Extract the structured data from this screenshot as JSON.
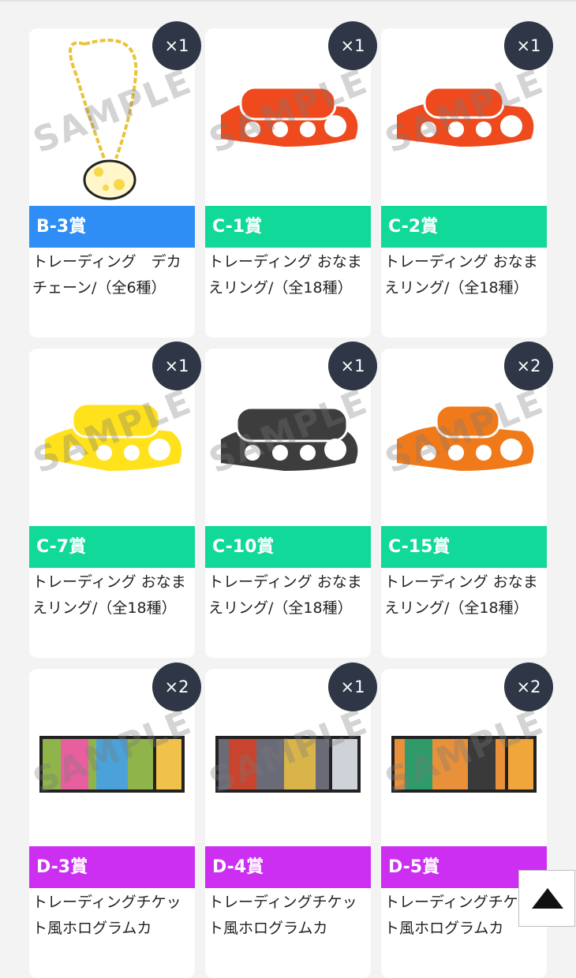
{
  "watermark": "SAMPLE",
  "colors": {
    "blue": "#2e8ef5",
    "green": "#10d99a",
    "purple": "#cc2ff2",
    "badge": "#2f3645"
  },
  "scroll_top_icon": "triangle-up-icon",
  "cards": [
    {
      "prize": "B-3賞",
      "color": "#2e8ef5",
      "qty": "×1",
      "desc": "トレーディング　デカチェーン/（全6種）",
      "image": "chain"
    },
    {
      "prize": "C-1賞",
      "color": "#10d99a",
      "qty": "×1",
      "desc": "トレーディング おなまえリング/（全18種）",
      "image": "ring-red-1"
    },
    {
      "prize": "C-2賞",
      "color": "#10d99a",
      "qty": "×1",
      "desc": "トレーディング おなまえリング/（全18種）",
      "image": "ring-red-2"
    },
    {
      "prize": "C-7賞",
      "color": "#10d99a",
      "qty": "×1",
      "desc": "トレーディング おなまえリング/（全18種）",
      "image": "ring-yellow"
    },
    {
      "prize": "C-10賞",
      "color": "#10d99a",
      "qty": "×1",
      "desc": "トレーディング おなまえリング/（全18種）",
      "image": "ring-black"
    },
    {
      "prize": "C-15賞",
      "color": "#10d99a",
      "qty": "×2",
      "desc": "トレーディング おなまえリング/（全18種）",
      "image": "ring-orange"
    },
    {
      "prize": "D-3賞",
      "color": "#cc2ff2",
      "qty": "×2",
      "desc": "トレーディングチケット風ホログラムカ",
      "image": "ticket-1"
    },
    {
      "prize": "D-4賞",
      "color": "#cc2ff2",
      "qty": "×1",
      "desc": "トレーディングチケット風ホログラムカ",
      "image": "ticket-2"
    },
    {
      "prize": "D-5賞",
      "color": "#cc2ff2",
      "qty": "×2",
      "desc": "トレーディングチケット風ホログラムカ",
      "image": "ticket-3"
    }
  ]
}
